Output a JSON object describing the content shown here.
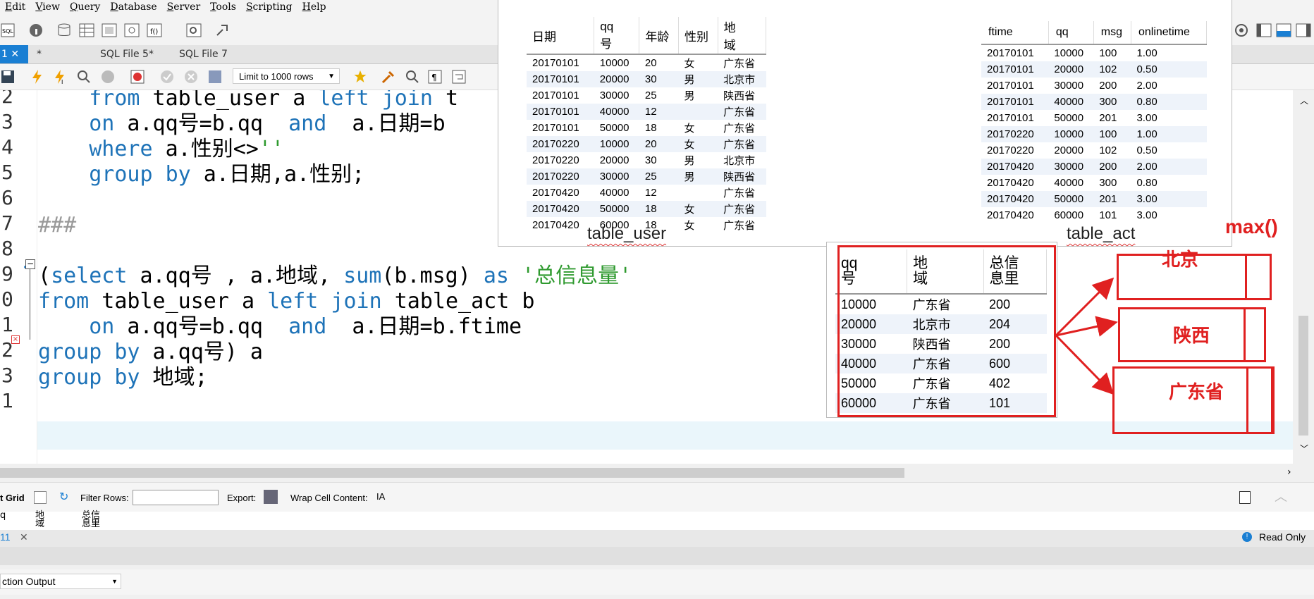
{
  "menu": [
    "Edit",
    "View",
    "Query",
    "Database",
    "Server",
    "Tools",
    "Scripting",
    "Help"
  ],
  "tabs": [
    {
      "label": "1 ✕",
      "active": true
    },
    {
      "label": "*"
    },
    {
      "label": "SQL File 5*"
    },
    {
      "label": "SQL File 7"
    }
  ],
  "sql_toolbar": {
    "limit": "Limit to 1000 rows"
  },
  "editor": {
    "line_numbers": [
      "2",
      "3",
      "4",
      "5",
      "6",
      "7",
      "8",
      "9",
      "0",
      "1",
      "2",
      "3",
      "1"
    ],
    "lines": [
      [
        "    ",
        {
          "k": "from"
        },
        " table_user a ",
        {
          "k": "left join"
        },
        " t"
      ],
      [
        "    ",
        {
          "k": "on"
        },
        " a.qq号=b.qq  ",
        {
          "k": "and"
        },
        "  a.日期=b"
      ],
      [
        "    ",
        {
          "k": "where"
        },
        " a.性别<>",
        {
          "s": "''"
        }
      ],
      [
        "    ",
        {
          "k": "group by"
        },
        " a.日期,a.性别;"
      ],
      [
        ""
      ],
      [
        {
          "c": "###"
        }
      ],
      [
        ""
      ],
      [
        "(",
        {
          "k": "select"
        },
        " a.qq号 , a.地域, ",
        {
          "k": "sum"
        },
        "(b.msg) ",
        {
          "k": "as"
        },
        " ",
        {
          "s": "'总信息量'"
        }
      ],
      [
        {
          "k": "from"
        },
        " table_user a ",
        {
          "k": "left join"
        },
        " table_act b"
      ],
      [
        "    ",
        {
          "k": "on"
        },
        " a.qq号=b.qq  ",
        {
          "k": "and"
        },
        "  a.日期=b.ftime"
      ],
      [
        {
          "k": "group by"
        },
        " a.qq号) a"
      ],
      [
        {
          "k": "group by"
        },
        " 地域;"
      ],
      [
        ""
      ]
    ]
  },
  "result_toolbar": {
    "grid": "t Grid",
    "filter": "Filter Rows:",
    "export": "Export:",
    "wrap": "Wrap Cell Content:"
  },
  "result_columns": [
    "q",
    "地\n域",
    "总信\n息里"
  ],
  "result_tab": "11",
  "read_only": "Read Only",
  "output_select": "ction Output",
  "table_user": {
    "caption": "table_user",
    "headers": [
      "日期",
      "qq\n号",
      "年龄",
      "性别",
      "地\n域"
    ],
    "rows": [
      [
        "20170101",
        "10000",
        "20",
        "女",
        "广东省"
      ],
      [
        "20170101",
        "20000",
        "30",
        "男",
        "北京市"
      ],
      [
        "20170101",
        "30000",
        "25",
        "男",
        "陕西省"
      ],
      [
        "20170101",
        "40000",
        "12",
        "",
        "广东省"
      ],
      [
        "20170101",
        "50000",
        "18",
        "女",
        "广东省"
      ],
      [
        "20170220",
        "10000",
        "20",
        "女",
        "广东省"
      ],
      [
        "20170220",
        "20000",
        "30",
        "男",
        "北京市"
      ],
      [
        "20170220",
        "30000",
        "25",
        "男",
        "陕西省"
      ],
      [
        "20170420",
        "40000",
        "12",
        "",
        "广东省"
      ],
      [
        "20170420",
        "50000",
        "18",
        "女",
        "广东省"
      ],
      [
        "20170420",
        "60000",
        "18",
        "女",
        "广东省"
      ]
    ]
  },
  "table_act": {
    "caption": "table_act",
    "headers": [
      "ftime",
      "qq",
      "msg",
      "onlinetime"
    ],
    "rows": [
      [
        "20170101",
        "10000",
        "100",
        "1.00"
      ],
      [
        "20170101",
        "20000",
        "102",
        "0.50"
      ],
      [
        "20170101",
        "30000",
        "200",
        "2.00"
      ],
      [
        "20170101",
        "40000",
        "300",
        "0.80"
      ],
      [
        "20170101",
        "50000",
        "201",
        "3.00"
      ],
      [
        "20170220",
        "10000",
        "100",
        "1.00"
      ],
      [
        "20170220",
        "20000",
        "102",
        "0.50"
      ],
      [
        "20170420",
        "30000",
        "200",
        "2.00"
      ],
      [
        "20170420",
        "40000",
        "300",
        "0.80"
      ],
      [
        "20170420",
        "50000",
        "201",
        "3.00"
      ],
      [
        "20170420",
        "60000",
        "101",
        "3.00"
      ]
    ]
  },
  "result_table": {
    "headers": [
      "qq\n号",
      "地\n域",
      "总信\n息里"
    ],
    "rows": [
      [
        "10000",
        "广东省",
        "200"
      ],
      [
        "20000",
        "北京市",
        "204"
      ],
      [
        "30000",
        "陕西省",
        "200"
      ],
      [
        "40000",
        "广东省",
        "600"
      ],
      [
        "50000",
        "广东省",
        "402"
      ],
      [
        "60000",
        "广东省",
        "101"
      ]
    ]
  },
  "annotations": {
    "max": "max()",
    "beijing": "北京",
    "shaanxi": "陕西",
    "guangdong": "广东省",
    "color": "#e02020"
  }
}
